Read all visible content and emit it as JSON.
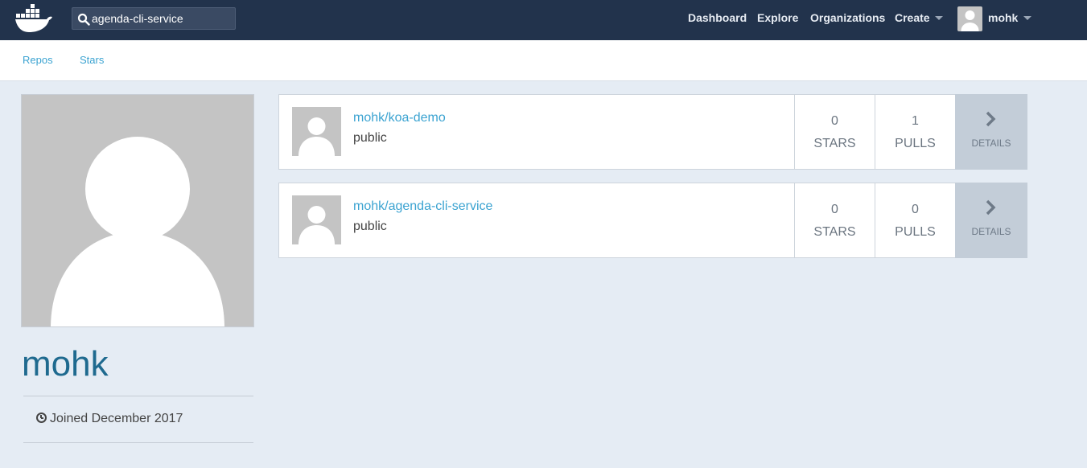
{
  "header": {
    "logo_icon": "docker-whale-icon",
    "search": {
      "value": "agenda-cli-service",
      "icon": "search-icon"
    },
    "nav": [
      "Dashboard",
      "Explore",
      "Organizations",
      "Create"
    ],
    "user": {
      "name": "mohk",
      "avatar_icon": "user-avatar-icon"
    }
  },
  "subnav": {
    "tabs": [
      "Repos",
      "Stars"
    ]
  },
  "profile": {
    "username": "mohk",
    "joined": "Joined December 2017",
    "joined_icon": "clock-icon"
  },
  "repos": [
    {
      "name": "mohk/koa-demo",
      "visibility": "public",
      "stars": "0",
      "stars_label": "STARS",
      "pulls": "1",
      "pulls_label": "PULLS",
      "details_label": "DETAILS"
    },
    {
      "name": "mohk/agenda-cli-service",
      "visibility": "public",
      "stars": "0",
      "stars_label": "STARS",
      "pulls": "0",
      "pulls_label": "PULLS",
      "details_label": "DETAILS"
    }
  ],
  "colors": {
    "topbar": "#22334c",
    "link": "#3ba3d1",
    "page_bg": "#e5ecf4",
    "username": "#1f6a8f"
  }
}
